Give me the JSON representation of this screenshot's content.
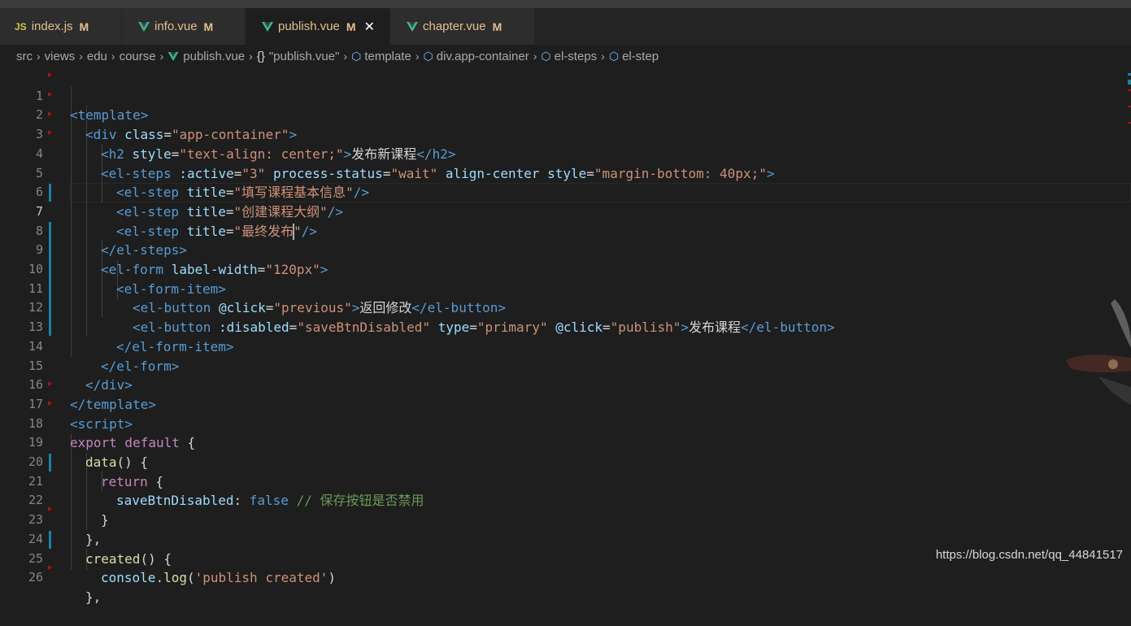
{
  "tabs": [
    {
      "icon": "JS",
      "label": "index.js",
      "modified": "M",
      "close": ""
    },
    {
      "icon": "vue",
      "label": "info.vue",
      "modified": "M",
      "close": ""
    },
    {
      "icon": "vue",
      "label": "publish.vue",
      "modified": "M",
      "close": "✕"
    },
    {
      "icon": "vue",
      "label": "chapter.vue",
      "modified": "M",
      "close": ""
    }
  ],
  "breadcrumb": {
    "src": "src",
    "views": "views",
    "edu": "edu",
    "course": "course",
    "file": "publish.vue",
    "obj_icon": "{}",
    "obj": "\"publish.vue\"",
    "template": "template",
    "container": "div.app-container",
    "steps": "el-steps",
    "step": "el-step"
  },
  "line_numbers": [
    "1",
    "2",
    "3",
    "4",
    "5",
    "6",
    "7",
    "8",
    "9",
    "10",
    "11",
    "12",
    "13",
    "14",
    "15",
    "16",
    "17",
    "18",
    "19",
    "20",
    "21",
    "22",
    "23",
    "24",
    "25",
    "26"
  ],
  "code": {
    "l1": {
      "a": "<template>"
    },
    "l2": {
      "a": "<div ",
      "b": "class",
      "c": "=",
      "d": "\"app-container\"",
      "e": ">"
    },
    "l3": {
      "a": "<h2 ",
      "b": "style",
      "c": "=",
      "d": "\"text-align: center;\"",
      "e": ">",
      "f": "发布新课程",
      "g": "</h2>"
    },
    "l4": {
      "a": "<el-steps ",
      "b": ":active",
      "c": "=",
      "d": "\"3\"",
      "e": " process-status",
      "f": "=",
      "g": "\"wait\"",
      "h": " align-center style",
      "i": "=",
      "j": "\"margin-bottom: 40px;\"",
      "k": ">"
    },
    "l5": {
      "a": "<el-step ",
      "b": "title",
      "c": "=",
      "d": "\"填写课程基本信息\"",
      "e": "/>"
    },
    "l6": {
      "a": "<el-step ",
      "b": "title",
      "c": "=",
      "d": "\"创建课程大纲\"",
      "e": "/>"
    },
    "l7": {
      "a": "<el-step ",
      "b": "title",
      "c": "=",
      "d1": "\"最终发布",
      "d2": "\"",
      "e": "/>"
    },
    "l8": {
      "a": "</el-steps>"
    },
    "l9": {
      "a": "<el-form ",
      "b": "label-width",
      "c": "=",
      "d": "\"120px\"",
      "e": ">"
    },
    "l10": {
      "a": "<el-form-item>"
    },
    "l11": {
      "a": "<el-button ",
      "b": "@click",
      "c": "=",
      "d": "\"previous\"",
      "e": ">",
      "f": "返回修改",
      "g": "</el-button>"
    },
    "l12": {
      "a": "<el-button ",
      "b": ":disabled",
      "c": "=",
      "d": "\"saveBtnDisabled\"",
      "e": " type",
      "f": "=",
      "g": "\"primary\"",
      "h": " @click",
      "i": "=",
      "j": "\"publish\"",
      "k": ">",
      "l": "发布课程",
      "m": "</el-button>"
    },
    "l13": {
      "a": "</el-form-item>"
    },
    "l14": {
      "a": "</el-form>"
    },
    "l15": {
      "a": "</div>"
    },
    "l16": {
      "a": "</template>"
    },
    "l17": {
      "a": "<script>"
    },
    "l18": {
      "a": "export default",
      "b": " {"
    },
    "l19": {
      "a": "data",
      "b": "() {"
    },
    "l20": {
      "a": "return",
      "b": " {"
    },
    "l21": {
      "a": "saveBtnDisabled",
      "b": ": ",
      "c": "false",
      "d": " // 保存按钮是否禁用"
    },
    "l22": {
      "a": "}"
    },
    "l23": {
      "a": "},"
    },
    "l24": {
      "a": "created",
      "b": "() {"
    },
    "l25": {
      "a": "console",
      "b": ".",
      "c": "log",
      "d": "(",
      "e": "'publish created'",
      "f": ")"
    },
    "l26": {
      "a": "},"
    }
  },
  "watermark": "https://blog.csdn.net/qq_44841517",
  "colors": {
    "background": "#1e1e1e",
    "tag": "#569cd6",
    "attribute": "#9cdcfe",
    "string": "#ce9178",
    "keyword": "#c586c0",
    "function": "#dcdcaa",
    "comment": "#6a9955",
    "modified": "#e2c08d"
  }
}
